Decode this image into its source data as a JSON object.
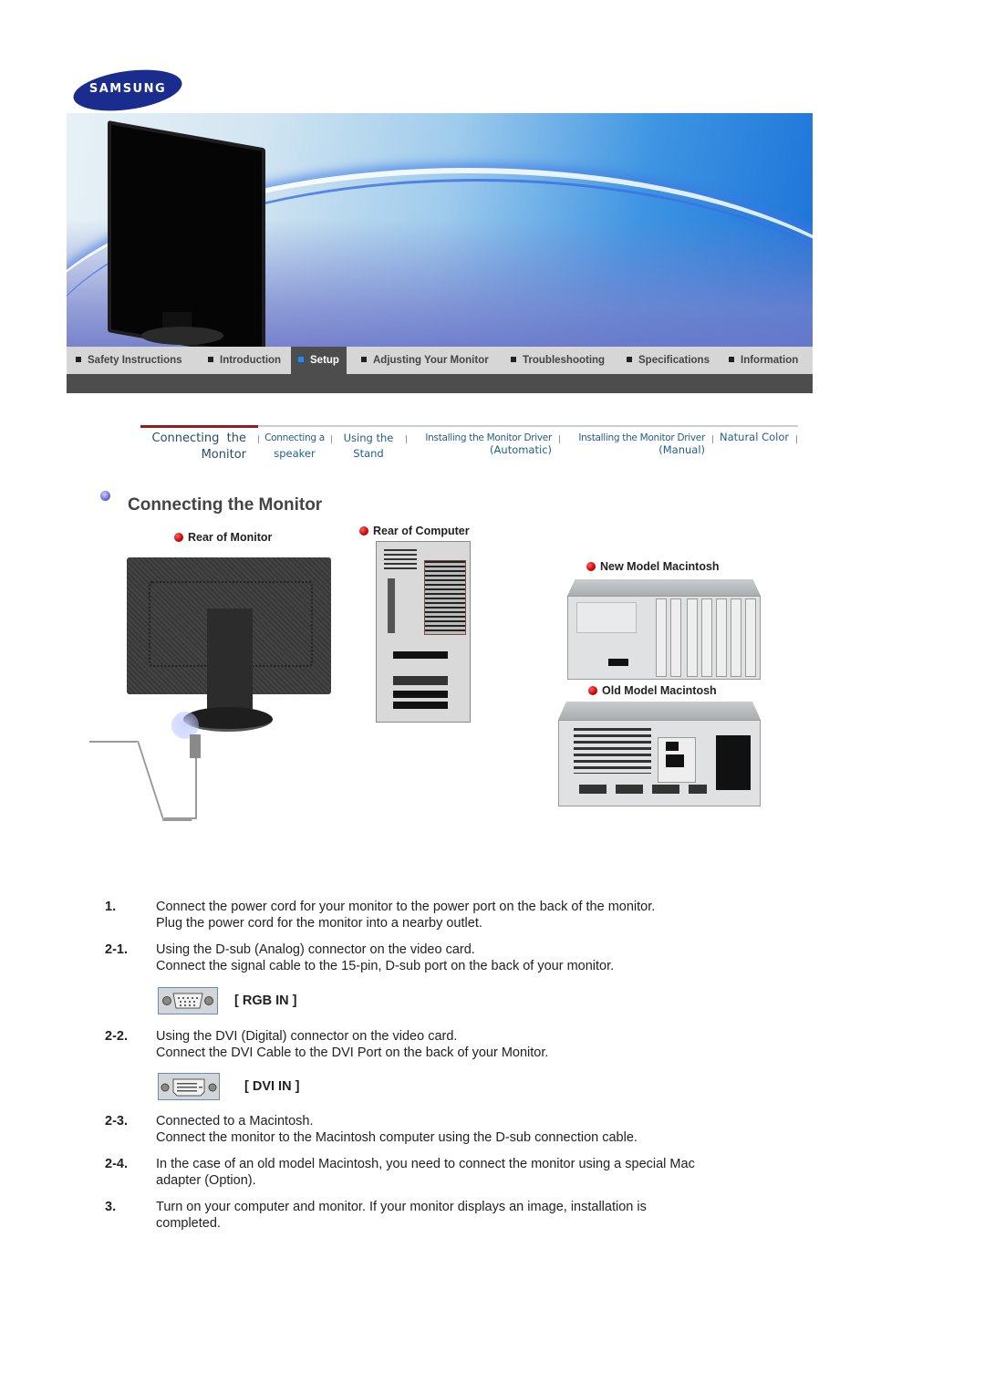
{
  "brand": {
    "logo_text": "SAMSUNG",
    "color": "#1a2d8f"
  },
  "nav": {
    "items": [
      {
        "label": "Safety Instructions",
        "active": false
      },
      {
        "label": "Introduction",
        "active": false
      },
      {
        "label": "Setup",
        "active": true
      },
      {
        "label": "Adjusting Your Monitor",
        "active": false
      },
      {
        "label": "Troubleshooting",
        "active": false
      },
      {
        "label": "Specifications",
        "active": false
      },
      {
        "label": "Information",
        "active": false
      }
    ],
    "active_color": "#1a8cff"
  },
  "subnav": {
    "items": [
      {
        "line1": "Connecting  the",
        "line2": "Monitor",
        "current": true
      },
      {
        "line1": "Connecting a",
        "line2": "speaker",
        "current": false
      },
      {
        "line1": "Using the",
        "line2": "Stand",
        "current": false
      },
      {
        "line1": "Installing the Monitor Driver",
        "line2": "(Automatic)",
        "current": false
      },
      {
        "line1": "Installing the Monitor Driver",
        "line2": "(Manual)",
        "current": false
      },
      {
        "line1": "Natural Color",
        "line2": "",
        "current": false
      }
    ]
  },
  "page": {
    "title": "Connecting the Monitor",
    "image_labels": {
      "rear_monitor": "Rear of Monitor",
      "rear_computer": "Rear of Computer",
      "new_mac": "New Model Macintosh",
      "old_mac": "Old Model Macintosh"
    }
  },
  "steps": [
    {
      "num": "1.",
      "lines": [
        "Connect the power cord for your monitor to the power port on the back of the monitor.",
        "Plug the power cord for the monitor into a nearby outlet."
      ]
    },
    {
      "num": "2-1.",
      "lines": [
        "Using the D-sub (Analog) connector on the video card.",
        "Connect the signal cable to the 15-pin, D-sub port on the back of your monitor."
      ]
    },
    {
      "num": "2-2.",
      "lines": [
        "Using the DVI (Digital) connector on the video card.",
        "Connect the DVI Cable to the DVI Port on the back of your Monitor."
      ]
    },
    {
      "num": "2-3.",
      "lines": [
        "Connected to a Macintosh.",
        "Connect the monitor to the Macintosh computer using the D-sub connection cable."
      ]
    },
    {
      "num": "2-4.",
      "lines": [
        "In the case of an old model Macintosh, you need to connect the monitor using a special Mac",
        "adapter (Option)."
      ]
    },
    {
      "num": "3.",
      "lines": [
        "Turn on your computer and monitor. If your monitor displays an image, installation is",
        "completed."
      ]
    }
  ],
  "ports": {
    "rgb": {
      "label": "[ RGB IN ]",
      "icon": "vga-port-icon"
    },
    "dvi": {
      "label": "[ DVI IN ]",
      "icon": "dvi-port-icon"
    }
  }
}
